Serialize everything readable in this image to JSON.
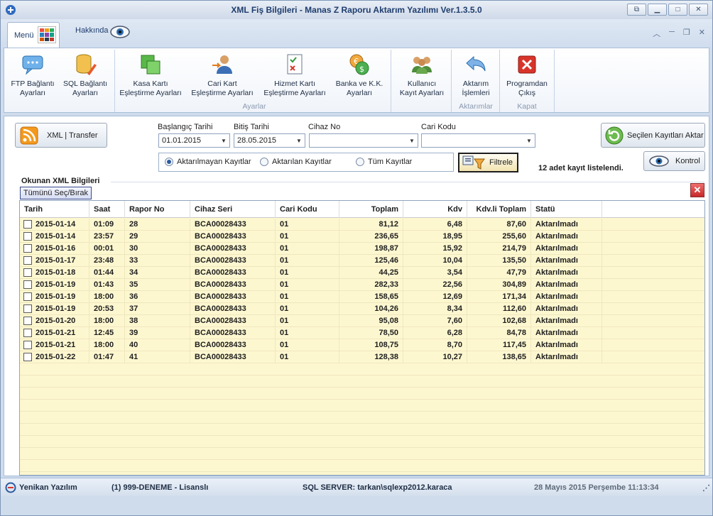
{
  "window": {
    "title": "XML Fiş Bilgileri - Manas Z Raporu Aktarım Yazılımı Ver.1.3.5.0"
  },
  "tabs": {
    "menu": "Menü",
    "about": "Hakkında"
  },
  "ribbon": {
    "ftp": [
      "FTP Bağlantı",
      "Ayarları"
    ],
    "sql": [
      "SQL Bağlantı",
      "Ayarları"
    ],
    "kasa": [
      "Kasa Kartı",
      "Eşleştirme Ayarları"
    ],
    "cari": [
      "Cari Kart",
      "Eşleştirme Ayarları"
    ],
    "hizmet": [
      "Hizmet Kartı",
      "Eşleştirme Ayarları"
    ],
    "banka": [
      "Banka ve K.K.",
      "Ayarları"
    ],
    "kullanici": [
      "Kullanıcı",
      "Kayıt Ayarları"
    ],
    "aktarim": [
      "Aktarım",
      "İşlemleri"
    ],
    "cikis": [
      "Programdan",
      "Çıkış"
    ],
    "group_ayarlar": "Ayarlar",
    "group_aktarimlar": "Aktarımlar",
    "group_kapat": "Kapat"
  },
  "toolbar": {
    "xml_transfer": "XML | Transfer",
    "start_label": "Başlangıç Tarihi",
    "start_value": "01.01.2015",
    "end_label": "Bitiş Tarihi",
    "end_value": "28.05.2015",
    "device_label": "Cihaz No",
    "device_value": "",
    "account_label": "Cari Kodu",
    "account_value": "",
    "radio_1": "Aktarılmayan Kayıtlar",
    "radio_2": "Aktarılan Kayıtlar",
    "radio_3": "Tüm Kayıtlar",
    "filter": "Filtrele",
    "count_text": "12 adet kayıt listelendi.",
    "send_selected": "Seçilen Kayıtları Aktar",
    "control": "Kontrol"
  },
  "section": {
    "title": "Okunan XML Bilgileri",
    "toggle": "Tümünü Seç/Bırak"
  },
  "table": {
    "columns": [
      "Tarih",
      "Saat",
      "Rapor No",
      "Cihaz Seri",
      "Cari Kodu",
      "Toplam",
      "Kdv",
      "Kdv.li Toplam",
      "Statü"
    ],
    "rows": [
      [
        "2015-01-14",
        "01:09",
        "28",
        "BCA00028433",
        "01",
        "81,12",
        "6,48",
        "87,60",
        "Aktarılmadı"
      ],
      [
        "2015-01-14",
        "23:57",
        "29",
        "BCA00028433",
        "01",
        "236,65",
        "18,95",
        "255,60",
        "Aktarılmadı"
      ],
      [
        "2015-01-16",
        "00:01",
        "30",
        "BCA00028433",
        "01",
        "198,87",
        "15,92",
        "214,79",
        "Aktarılmadı"
      ],
      [
        "2015-01-17",
        "23:48",
        "33",
        "BCA00028433",
        "01",
        "125,46",
        "10,04",
        "135,50",
        "Aktarılmadı"
      ],
      [
        "2015-01-18",
        "01:44",
        "34",
        "BCA00028433",
        "01",
        "44,25",
        "3,54",
        "47,79",
        "Aktarılmadı"
      ],
      [
        "2015-01-19",
        "01:43",
        "35",
        "BCA00028433",
        "01",
        "282,33",
        "22,56",
        "304,89",
        "Aktarılmadı"
      ],
      [
        "2015-01-19",
        "18:00",
        "36",
        "BCA00028433",
        "01",
        "158,65",
        "12,69",
        "171,34",
        "Aktarılmadı"
      ],
      [
        "2015-01-19",
        "20:53",
        "37",
        "BCA00028433",
        "01",
        "104,26",
        "8,34",
        "112,60",
        "Aktarılmadı"
      ],
      [
        "2015-01-20",
        "18:00",
        "38",
        "BCA00028433",
        "01",
        "95,08",
        "7,60",
        "102,68",
        "Aktarılmadı"
      ],
      [
        "2015-01-21",
        "12:45",
        "39",
        "BCA00028433",
        "01",
        "78,50",
        "6,28",
        "84,78",
        "Aktarılmadı"
      ],
      [
        "2015-01-21",
        "18:00",
        "40",
        "BCA00028433",
        "01",
        "108,75",
        "8,70",
        "117,45",
        "Aktarılmadı"
      ],
      [
        "2015-01-22",
        "01:47",
        "41",
        "BCA00028433",
        "01",
        "128,38",
        "10,27",
        "138,65",
        "Aktarılmadı"
      ]
    ]
  },
  "status": {
    "company": "Yenikan Yazılım",
    "license": "(1) 999-DENEME   - Lisanslı",
    "server": "SQL SERVER: tarkan\\sqlexp2012.karaca",
    "datetime": "28 Mayıs 2015 Perşembe 11:13:34"
  }
}
